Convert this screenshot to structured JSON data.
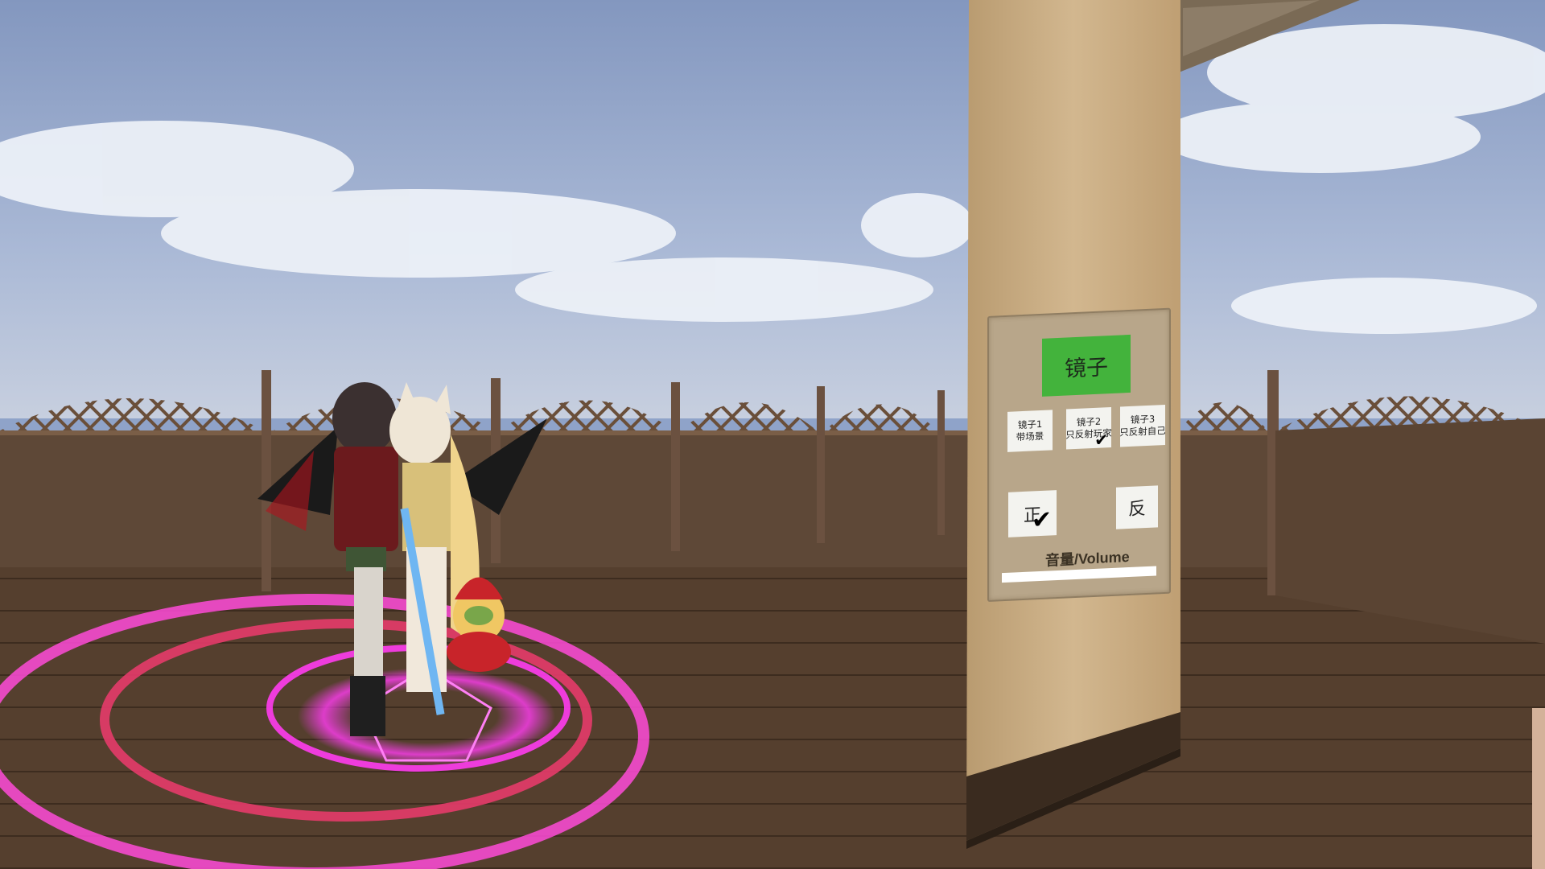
{
  "world": {
    "sky_color": "#8fa3c9",
    "floor_color": "#5b4431",
    "fence_color": "#6a4f3a",
    "pillar_color": "#c9ad84",
    "magic_circle_color": "#ff3cf0"
  },
  "mirror_panel": {
    "title": "镜子",
    "title_color": "#43b33c",
    "mirrors": [
      {
        "line1": "镜子1",
        "line2": "带场景",
        "selected": false
      },
      {
        "line1": "镜子2",
        "line2": "只反射玩家",
        "selected": true
      },
      {
        "line1": "镜子3",
        "line2": "只反射自己",
        "selected": false
      }
    ],
    "orientation": [
      {
        "label": "正",
        "selected": true
      },
      {
        "label": "反",
        "selected": false
      }
    ],
    "check_mark": "✔",
    "volume_label": "音量/Volume",
    "volume_level": 1.0
  }
}
